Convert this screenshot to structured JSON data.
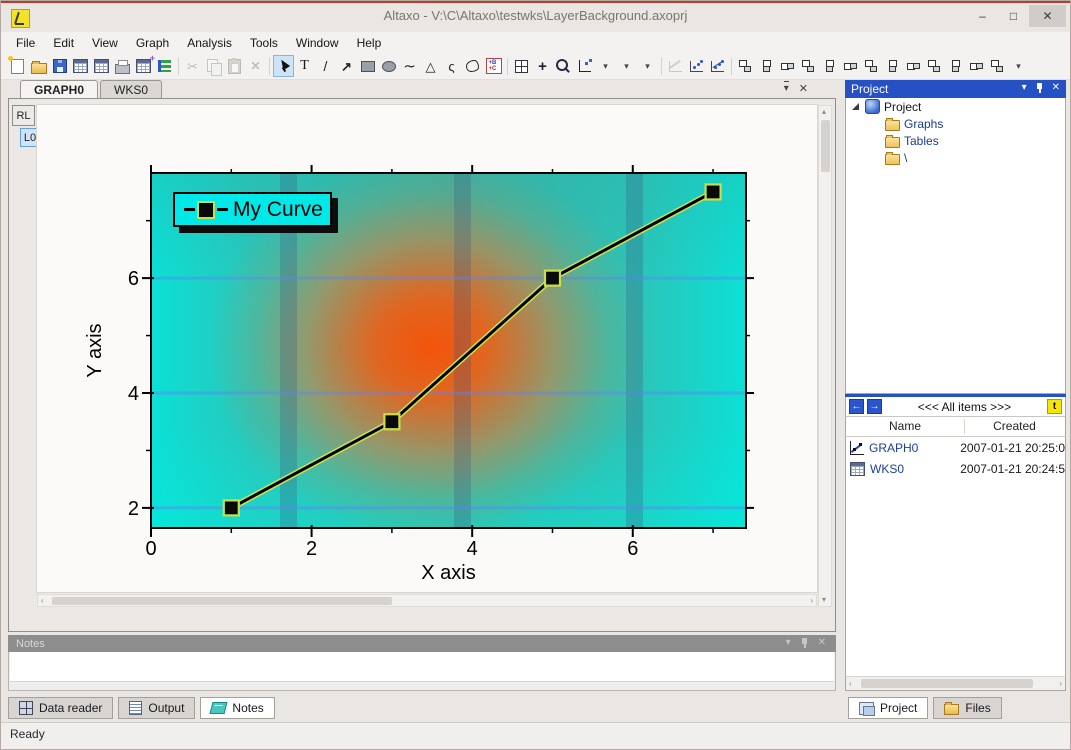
{
  "window": {
    "title": "Altaxo - V:\\C\\Altaxo\\testwks\\LayerBackground.axoprj",
    "controls": {
      "minimize": "–",
      "maximize": "□",
      "close": "✕"
    }
  },
  "glyphs": {
    "chevron_down": "▾",
    "close": "✕",
    "up": "▴",
    "down": "▾",
    "left": "‹",
    "right": "›"
  },
  "menu": {
    "items": [
      "File",
      "Edit",
      "View",
      "Graph",
      "Analysis",
      "Tools",
      "Window",
      "Help"
    ]
  },
  "toolbar": {
    "buttons": [
      {
        "name": "new-document"
      },
      {
        "name": "open-file"
      },
      {
        "name": "save"
      },
      {
        "name": "new-worksheet"
      },
      {
        "name": "open-worksheet"
      },
      {
        "name": "print"
      },
      {
        "name": "new-table"
      },
      {
        "name": "arrange-windows"
      },
      {
        "separator": true
      },
      {
        "name": "cut",
        "glyph": "✂",
        "disabled": true
      },
      {
        "name": "copy",
        "disabled": true
      },
      {
        "name": "paste",
        "disabled": true
      },
      {
        "name": "delete",
        "glyph": "✕",
        "disabled": true
      },
      {
        "separator": true
      },
      {
        "name": "pointer",
        "active": true
      },
      {
        "name": "text-tool",
        "glyph": "T"
      },
      {
        "name": "line-tool",
        "glyph": "/"
      },
      {
        "name": "arrow-tool",
        "glyph": "↗"
      },
      {
        "name": "rectangle-tool"
      },
      {
        "name": "ellipse-tool"
      },
      {
        "name": "curve-tool",
        "glyph": "∼"
      },
      {
        "name": "triangle-tool",
        "glyph": "△"
      },
      {
        "name": "open-curve-tool",
        "glyph": "ς"
      },
      {
        "name": "closed-curve-tool"
      },
      {
        "name": "label-tool"
      },
      {
        "separator": true
      },
      {
        "name": "zoom-region"
      },
      {
        "name": "move-plot",
        "glyph": "+"
      },
      {
        "name": "magnifier"
      },
      {
        "name": "axes-pointer"
      },
      {
        "name": "dropdown-arrow",
        "glyph": "▾"
      },
      {
        "name": "dropdown-arrow",
        "glyph": "▾"
      },
      {
        "name": "dropdown-arrow",
        "glyph": "▾"
      },
      {
        "separator": true
      },
      {
        "name": "function-plot",
        "disabled": true
      },
      {
        "name": "scatter-plot"
      },
      {
        "name": "line-scatter-plot"
      },
      {
        "separator": true
      },
      {
        "name": "align-top"
      },
      {
        "name": "align-bottom"
      },
      {
        "name": "align-horizontal"
      },
      {
        "name": "align-vertical"
      },
      {
        "name": "align-left"
      },
      {
        "name": "align-right"
      },
      {
        "name": "move-forward"
      },
      {
        "name": "move-backward"
      },
      {
        "name": "size-to-width"
      },
      {
        "name": "size-to-height"
      },
      {
        "name": "distribute-columns"
      },
      {
        "name": "distribute-rows"
      },
      {
        "name": "arrange-grid"
      },
      {
        "name": "toolbar-overflow",
        "glyph": "▾"
      }
    ]
  },
  "document_tabs": {
    "tabs": [
      {
        "label": "GRAPH0",
        "active": true
      },
      {
        "label": "WKS0",
        "active": false
      }
    ]
  },
  "layer_buttons": [
    {
      "label": "RL",
      "active": false
    },
    {
      "label": "L0",
      "active": true
    }
  ],
  "chart_data": {
    "type": "line",
    "series": [
      {
        "name": "My Curve",
        "x": [
          1,
          3,
          5,
          7
        ],
        "y": [
          2,
          3.5,
          6,
          7.5
        ]
      }
    ],
    "title": "",
    "xlabel": "X axis",
    "ylabel": "Y axis",
    "xlim": [
      0,
      7.41
    ],
    "ylim": [
      1.65,
      7.83
    ],
    "x_major_ticks": [
      0,
      2,
      4,
      6
    ],
    "x_minor_ticks": [
      1,
      3,
      5,
      7
    ],
    "y_major_ticks": [
      2,
      4,
      6
    ],
    "y_minor_ticks": [
      3,
      5,
      7
    ],
    "gridlines_y": [
      2,
      4,
      6
    ],
    "grid": "horizontal blue lines on gradient background",
    "legend_position": "top-left inside plot",
    "line_color": "#000000",
    "line_halo_color": "#cde14d",
    "marker": "filled-square",
    "marker_color": "#0a0a0a",
    "marker_outline": "#c9df49",
    "background": "radial orange center fading to cyan edges with dark vertical bands"
  },
  "project_panel": {
    "title": "Project",
    "tree": [
      {
        "label": "Project",
        "icon": "project-root",
        "level": 0,
        "expanded": true
      },
      {
        "label": "Graphs",
        "icon": "folder",
        "level": 1
      },
      {
        "label": "Tables",
        "icon": "folder",
        "level": 1
      },
      {
        "label": "\\",
        "icon": "folder",
        "level": 1
      }
    ]
  },
  "items_panel": {
    "nav_back": "←",
    "nav_forward": "→",
    "title": "<<< All items >>>",
    "sort_button": "t",
    "columns": [
      "Name",
      "Created"
    ],
    "rows": [
      {
        "icon": "graph-file",
        "name": "GRAPH0",
        "created": "2007-01-21 20:25:0"
      },
      {
        "icon": "worksheet-file",
        "name": "WKS0",
        "created": "2007-01-21 20:24:5"
      }
    ]
  },
  "panel_tabs": [
    {
      "label": "Project",
      "icon": "project-tab",
      "active": true
    },
    {
      "label": "Files",
      "icon": "files-tab",
      "active": false
    }
  ],
  "notes_panel": {
    "title": "Notes"
  },
  "bottom_tabs": [
    {
      "label": "Data reader",
      "icon": "data-reader",
      "active": false
    },
    {
      "label": "Output",
      "icon": "output",
      "active": false
    },
    {
      "label": "Notes",
      "icon": "notes",
      "active": true
    }
  ],
  "status_bar": {
    "text": "Ready"
  },
  "colors": {
    "accent_blue": "#2551c5",
    "titlebar_accent": "#bf3a28",
    "legend_bg": "#00e9e9",
    "plot_cyan": "#17d3c9",
    "plot_orange": "#ea5c12",
    "marker_outline": "#c9df49"
  }
}
